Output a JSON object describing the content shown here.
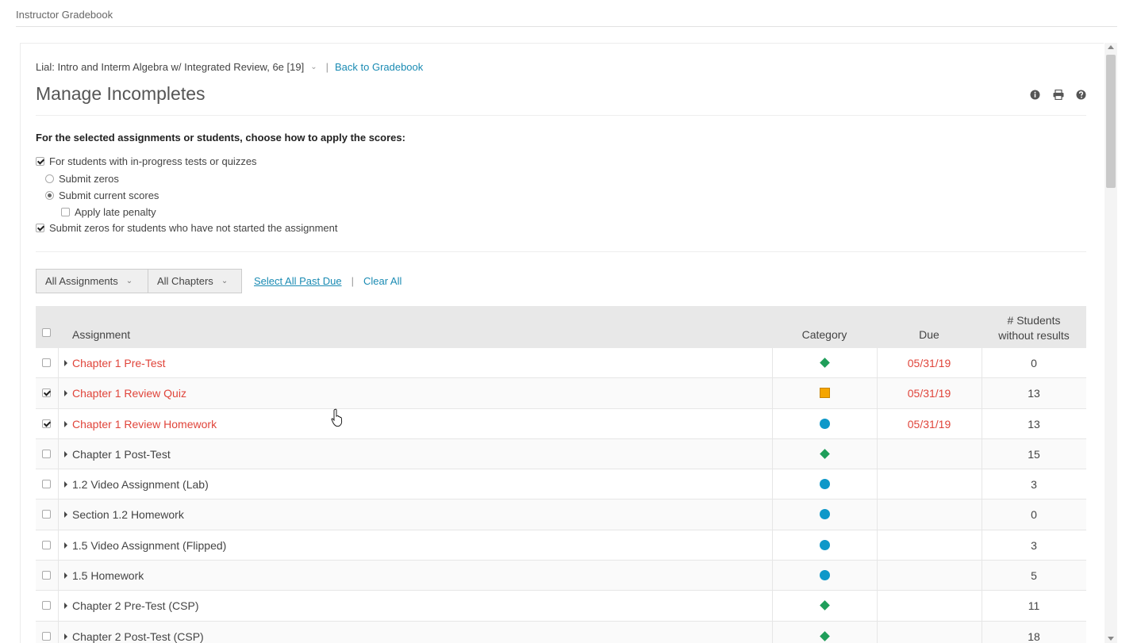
{
  "app": {
    "title": "Instructor Gradebook"
  },
  "header": {
    "course_name": "Lial: Intro and Interm Algebra w/ Integrated Review, 6e [19]",
    "separator": "|",
    "back_link": "Back to Gradebook",
    "page_title": "Manage Incompletes",
    "icons": [
      "info-icon",
      "print-icon",
      "help-icon"
    ]
  },
  "options": {
    "instruction": "For the selected assignments or students, choose how to apply the scores:",
    "in_progress": {
      "label": "For students with in-progress tests or quizzes",
      "checked": true
    },
    "submit_zeros": {
      "label": "Submit zeros",
      "selected": false
    },
    "submit_current": {
      "label": "Submit current scores",
      "selected": true
    },
    "late_penalty": {
      "label": "Apply late penalty",
      "checked": false
    },
    "not_started": {
      "label": "Submit zeros for students who have not started the assignment",
      "checked": true
    }
  },
  "filters": {
    "assignments_select": "All Assignments",
    "chapters_select": "All Chapters",
    "select_all_past_due": "Select All Past Due",
    "separator": "|",
    "clear_all": "Clear All"
  },
  "table": {
    "columns": {
      "assignment": "Assignment",
      "category": "Category",
      "due": "Due",
      "students_line1": "# Students",
      "students_line2": "without results"
    },
    "rows": [
      {
        "name": "Chapter 1 Pre-Test",
        "checked": false,
        "late": true,
        "category": "diamond",
        "due": "05/31/19",
        "students": "0"
      },
      {
        "name": "Chapter 1 Review Quiz",
        "checked": true,
        "late": true,
        "category": "square",
        "due": "05/31/19",
        "students": "13"
      },
      {
        "name": "Chapter 1 Review Homework",
        "checked": true,
        "late": true,
        "category": "circle",
        "due": "05/31/19",
        "students": "13"
      },
      {
        "name": "Chapter 1 Post-Test",
        "checked": false,
        "late": false,
        "category": "diamond",
        "due": "",
        "students": "15"
      },
      {
        "name": "1.2 Video Assignment (Lab)",
        "checked": false,
        "late": false,
        "category": "circle",
        "due": "",
        "students": "3"
      },
      {
        "name": "Section 1.2 Homework",
        "checked": false,
        "late": false,
        "category": "circle",
        "due": "",
        "students": "0"
      },
      {
        "name": "1.5 Video Assignment (Flipped)",
        "checked": false,
        "late": false,
        "category": "circle",
        "due": "",
        "students": "3"
      },
      {
        "name": "1.5 Homework",
        "checked": false,
        "late": false,
        "category": "circle",
        "due": "",
        "students": "5"
      },
      {
        "name": "Chapter 2 Pre-Test (CSP)",
        "checked": false,
        "late": false,
        "category": "diamond",
        "due": "",
        "students": "11"
      },
      {
        "name": "Chapter 2 Post-Test (CSP)",
        "checked": false,
        "late": false,
        "category": "diamond",
        "due": "",
        "students": "18"
      }
    ]
  },
  "colors": {
    "late_red": "#e0443a",
    "link_blue": "#1a8bb3",
    "test_green": "#1f9e5a",
    "quiz_orange": "#f5a500",
    "homework_blue": "#0e98c9"
  }
}
